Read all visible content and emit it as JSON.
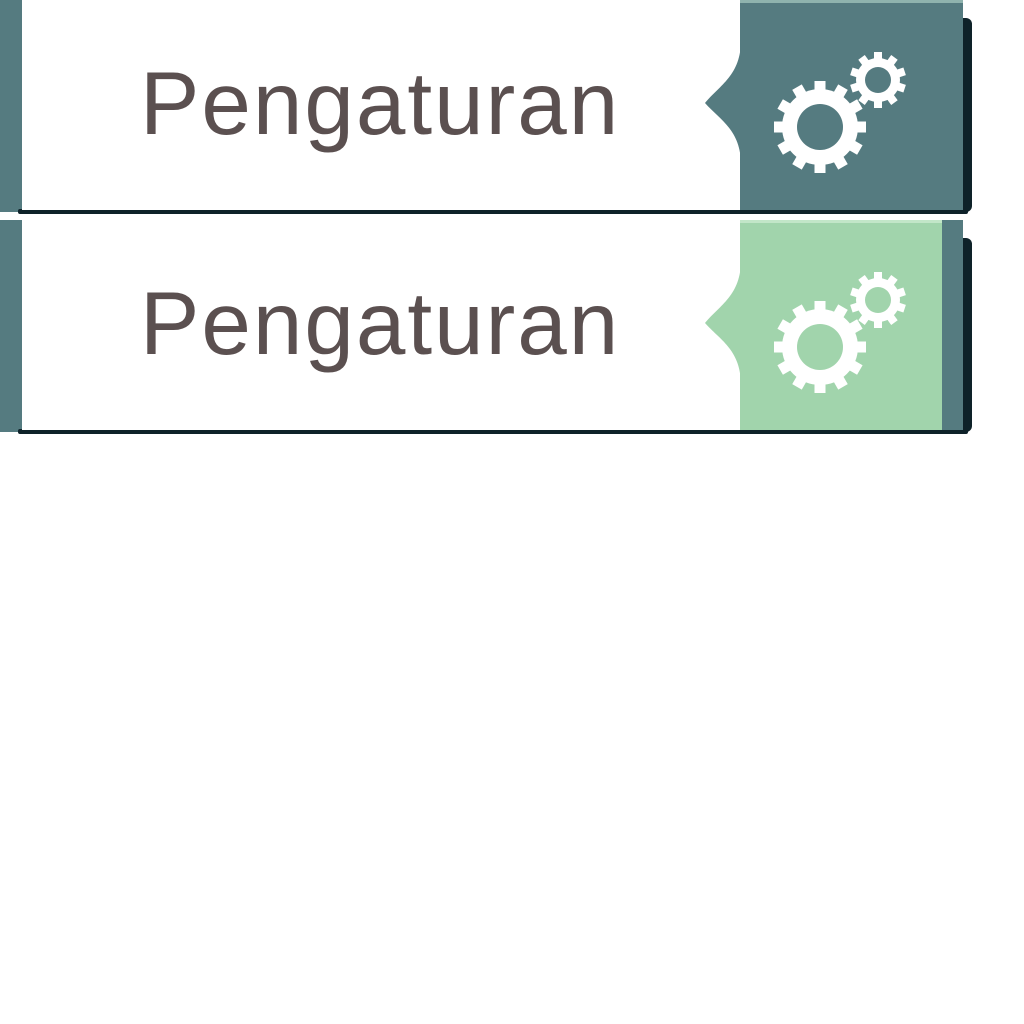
{
  "buttons": [
    {
      "label": "Pengaturan",
      "icon": "gears-icon",
      "state": "normal",
      "panel_color": "#557b80"
    },
    {
      "label": "Pengaturan",
      "icon": "gears-icon",
      "state": "hover",
      "panel_color": "#a1d4ac"
    }
  ],
  "colors": {
    "teal": "#557b80",
    "green": "#a1d4ac",
    "text": "#5b5050",
    "shadow": "#0e2229"
  }
}
